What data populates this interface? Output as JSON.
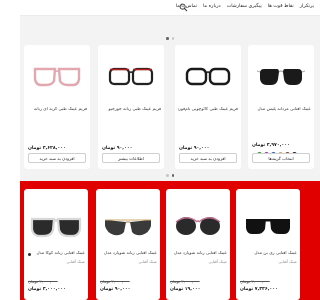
{
  "nav": {
    "items": [
      "پرتکرار",
      "نقاط قوت ها",
      "پیگیری سفارشات",
      "درباره ما",
      "تماس با ما"
    ]
  },
  "colors": {
    "accent_red": "#e00000",
    "swatches": [
      "#222222",
      "#7a4b2c",
      "#c9a86a",
      "#2b5fb5",
      "#9a3b9e",
      "#2d8f3a"
    ]
  },
  "section1": {
    "cards": [
      {
        "title": "عینک آفتابی مردانه پلیس مدل",
        "price": "۳,۹۷۰,۰۰۰ تومان",
        "swatch_label": "طوسی",
        "button": "انتخاب گزینه‌ها"
      },
      {
        "title": "فریم عینک طبی کائوچویی تام‌فورد",
        "price": "۹۰,۰۰۰ تومان",
        "button": "افزودن به سبد خرید"
      },
      {
        "title": "فریم عینک طبی زنانه جورجیو",
        "price": "۹۰,۰۰۰ تومان",
        "button": "اطلاعات بیشتر"
      },
      {
        "title": "فریم عینک طبی گربه ای زنانه",
        "price": "۳,۶۲۸,۰۰۰ تومان",
        "button": "افزودن به سبد خرید"
      }
    ]
  },
  "section2": {
    "cards": [
      {
        "title": "عینک آفتابی ری بن مدل",
        "sub": "عینک آفتابی",
        "old_price": "۲,۰۰۰,۰۰۰ تومان",
        "new_price": "۷,۳۳۶,۰۰۰ تومان"
      },
      {
        "title": "عینک آفتابی زنانه شوپارد مدل",
        "sub": "عینک آفتابی",
        "old_price": "۲,۰۰۰,۰۰۰ تومان",
        "new_price": "۱۹,۰۰۰ تومان"
      },
      {
        "title": "عینک آفتابی زنانه شوپارد مدل",
        "sub": "عینک آفتابی",
        "old_price": "۲,۰۰۰,۰۰۰ تومان",
        "new_price": "۹۰,۰۰۰ تومان"
      },
      {
        "title": "عینک آفتابی زنانه کوکا مدل",
        "sub": "عینک آفتابی",
        "old_price": "۲,۰۰۰,۰۰۰ تومان",
        "new_price": "۳,۰۰۰,۰۰۰ تومان"
      }
    ]
  }
}
